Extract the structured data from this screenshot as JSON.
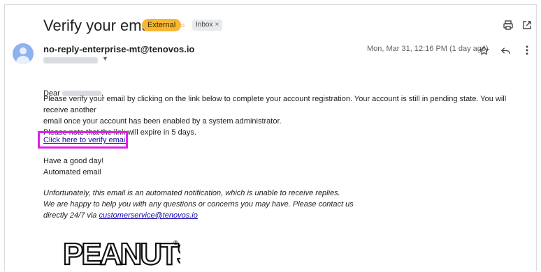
{
  "email": {
    "subject": "Verify your email",
    "labels": {
      "external": "External",
      "inbox": "Inbox",
      "inbox_remove": "×"
    },
    "sender": "no-reply-enterprise-mt@tenovos.io",
    "date": "Mon, Mar 31, 12:16 PM (1 day ago)",
    "greeting": "Dear",
    "greeting_punct": ",",
    "paragraph1_line1": "Please verify your email by clicking on the link below to complete your account registration. Your account is still in pending state. You will receive another",
    "paragraph1_line2": "email once your account has been enabled by a system administrator.",
    "paragraph2": "Please note that the link will expire in 5 days.",
    "verify_link": "Click here to verify email",
    "closing1": "Have a good day!",
    "closing2": "Automated email",
    "footer_line1": "Unfortunately, this email is an automated notification, which is unable to receive replies.",
    "footer_line2": "We are happy to help you with any questions or concerns you may have. Please contact us",
    "footer_line3_prefix": "directly 24/7 via ",
    "support_email": "customerservice@tenovos.io",
    "logo_text": "PEANUTS",
    "logo_mark": "®"
  },
  "colors": {
    "highlight": "#e020e8",
    "external_chip": "#f7b733",
    "link": "#1a0dab"
  },
  "icons": [
    "print-icon",
    "open-in-new-window-icon",
    "star-icon",
    "reply-icon",
    "more-vert-icon",
    "importance-marker-icon",
    "avatar-icon"
  ]
}
